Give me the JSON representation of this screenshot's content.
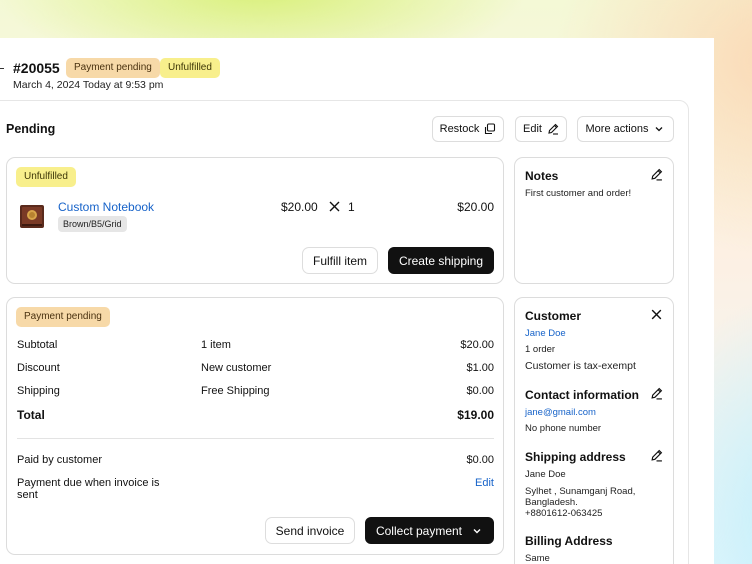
{
  "order": {
    "id": "#20055",
    "payment_badge": "Payment pending",
    "fulfillment_badge": "Unfulfilled",
    "date": "March 4, 2024 Today at 9:53 pm"
  },
  "section": {
    "title": "Pending",
    "restock_label": "Restock",
    "edit_label": "Edit",
    "more_actions_label": "More actions"
  },
  "fulfillment": {
    "badge": "Unfulfilled",
    "product_name": "Custom Notebook",
    "variant": "Brown/B5/Grid",
    "unit_price": "$20.00",
    "quantity": "1",
    "line_total": "$20.00",
    "fulfill_label": "Fulfill item",
    "create_shipping_label": "Create shipping"
  },
  "payment": {
    "badge": "Payment pending",
    "rows": [
      {
        "label": "Subtotal",
        "detail": "1 item",
        "amount": "$20.00"
      },
      {
        "label": "Discount",
        "detail": "New customer",
        "amount": "$1.00"
      },
      {
        "label": "Shipping",
        "detail": "Free Shipping",
        "amount": "$0.00"
      }
    ],
    "total_label": "Total",
    "total_amount": "$19.00",
    "paid_label": "Paid by customer",
    "paid_amount": "$0.00",
    "due_label": "Payment due when invoice is sent",
    "due_edit": "Edit",
    "send_invoice_label": "Send invoice",
    "collect_payment_label": "Collect payment"
  },
  "notes": {
    "title": "Notes",
    "text": "First customer and order!"
  },
  "customer": {
    "title": "Customer",
    "name": "Jane Doe",
    "orders": "1 order",
    "tax": "Customer is tax-exempt",
    "contact_title": "Contact information",
    "email": "jane@gmail.com",
    "phone": "No phone number",
    "shipping_title": "Shipping address",
    "ship_name": "Jane Doe",
    "ship_line1": "Sylhet , Sunamganj Road,",
    "ship_line2": "Bangladesh.",
    "ship_phone": "+8801612-063425",
    "billing_title": "Billing Address",
    "billing_text": "Same"
  },
  "colors": {
    "link": "#1763c9",
    "badge_orange": "#f7d9a8",
    "badge_yellow": "#f8ef8c",
    "primary_button": "#111111"
  },
  "icons": {
    "restock": "copy-icon",
    "edit": "pencil-icon",
    "more": "chevron-down-icon",
    "quantity": "times-icon",
    "close": "close-icon"
  }
}
